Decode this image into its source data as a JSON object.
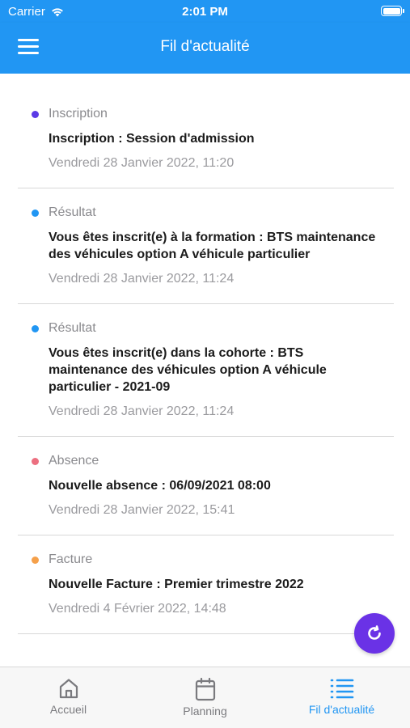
{
  "status_bar": {
    "carrier": "Carrier",
    "time": "2:01 PM"
  },
  "header": {
    "title": "Fil d'actualité"
  },
  "feed": [
    {
      "category": "Inscription",
      "headline": "Inscription : Session d'admission",
      "date": "Vendredi 28 Janvier 2022, 11:20",
      "dot_color": "#5b3ae6"
    },
    {
      "category": "Résultat",
      "headline": "Vous êtes inscrit(e) à la formation : BTS maintenance des véhicules option A véhicule particulier",
      "date": "Vendredi 28 Janvier 2022, 11:24",
      "dot_color": "#2196f3"
    },
    {
      "category": "Résultat",
      "headline": "Vous êtes inscrit(e) dans la cohorte : BTS maintenance des véhicules option A véhicule particulier - 2021-09",
      "date": "Vendredi 28 Janvier 2022, 11:24",
      "dot_color": "#2196f3"
    },
    {
      "category": "Absence",
      "headline": "Nouvelle absence : 06/09/2021 08:00",
      "date": "Vendredi 28 Janvier 2022, 15:41",
      "dot_color": "#ec6f80"
    },
    {
      "category": "Facture",
      "headline": "Nouvelle Facture : Premier trimestre 2022",
      "date": "Vendredi 4 Février 2022, 14:48",
      "dot_color": "#f5a04a"
    }
  ],
  "tabs": [
    {
      "label": "Accueil",
      "icon": "home-icon",
      "active": false
    },
    {
      "label": "Planning",
      "icon": "calendar-icon",
      "active": false
    },
    {
      "label": "Fil d'actualité",
      "icon": "list-icon",
      "active": true
    }
  ],
  "colors": {
    "primary": "#2196f3",
    "fab": "#6a32e6",
    "inactive_tab": "#7a7a7e"
  }
}
